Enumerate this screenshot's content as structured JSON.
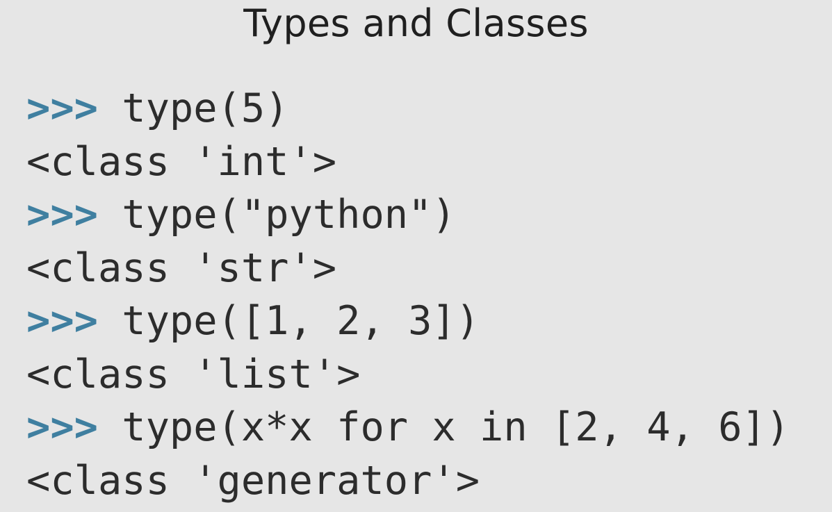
{
  "slide": {
    "title": "Types and Classes",
    "accent_color": "#3f7fa0",
    "text_color": "#2c2c2c",
    "background_color": "#e6e6e6"
  },
  "code": {
    "prompt": ">>>",
    "lines": [
      {
        "kind": "input",
        "text": "type(5)"
      },
      {
        "kind": "output",
        "text": "<class 'int'>"
      },
      {
        "kind": "input",
        "text": "type(\"python\")"
      },
      {
        "kind": "output",
        "text": "<class 'str'>"
      },
      {
        "kind": "input",
        "text": "type([1, 2, 3])"
      },
      {
        "kind": "output",
        "text": "<class 'list'>"
      },
      {
        "kind": "input",
        "text": "type(x*x for x in [2, 4, 6])"
      },
      {
        "kind": "output",
        "text": "<class 'generator'>"
      }
    ]
  }
}
